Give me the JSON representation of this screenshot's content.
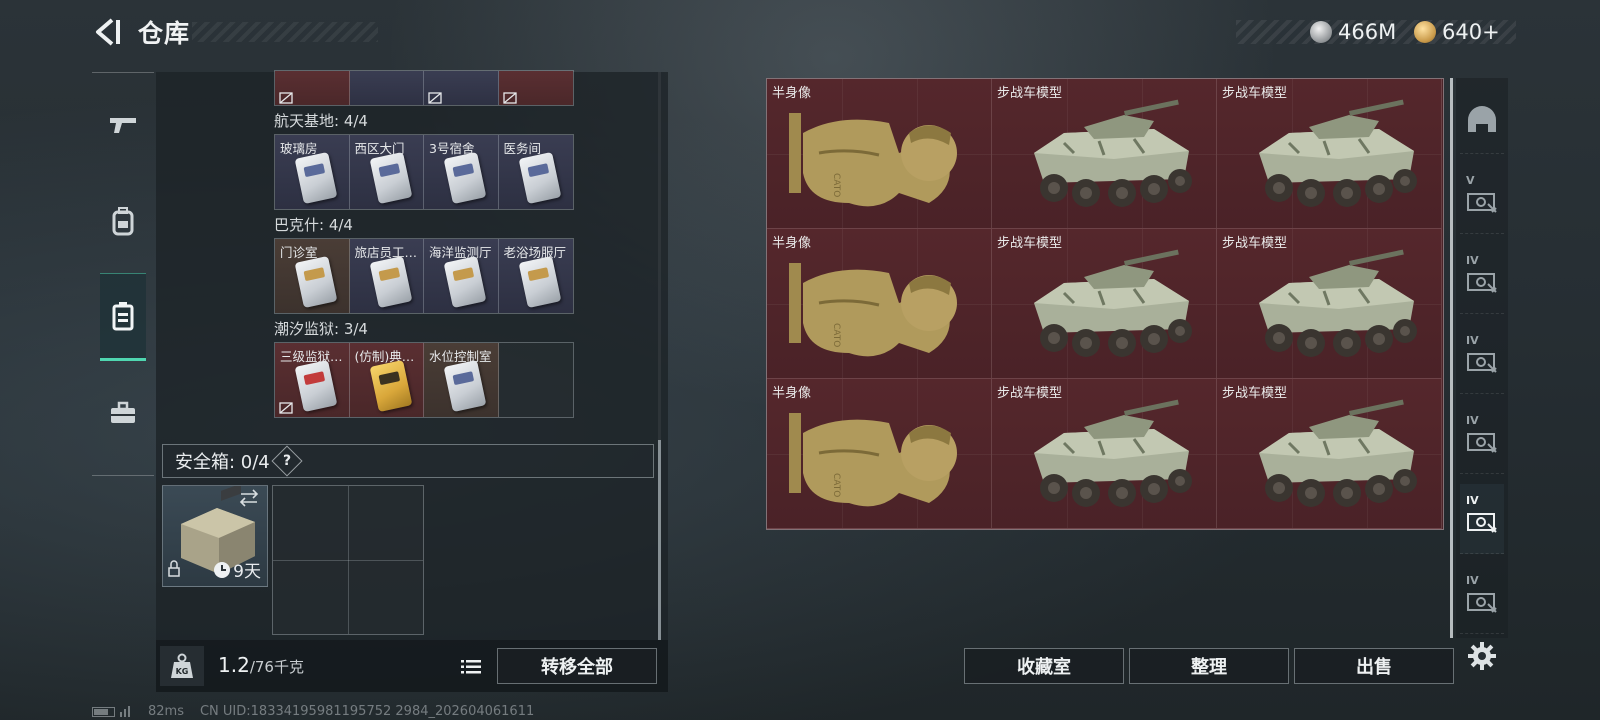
{
  "header": {
    "title": "仓库"
  },
  "currency": [
    {
      "name": "silver-coin",
      "value": "466M"
    },
    {
      "name": "gold-coin",
      "value": "640+"
    }
  ],
  "left_nav": [
    {
      "icon": "gun-icon"
    },
    {
      "icon": "backpack-icon"
    },
    {
      "icon": "key-case-icon",
      "active": true
    },
    {
      "icon": "toolbox-icon"
    }
  ],
  "storage": {
    "groups": [
      {
        "label": "航天基地: 4/4",
        "items": [
          "玻璃房",
          "西区大门",
          "3号宿舍",
          "医务间"
        ]
      },
      {
        "label": "巴克什: 4/4",
        "items": [
          "门诊室",
          "旅店员工…",
          "海洋监测厅",
          "老浴场服厅"
        ]
      },
      {
        "label": "潮汐监狱: 3/4",
        "items": [
          "三级监狱…",
          "(仿制)典…",
          "水位控制室"
        ]
      }
    ]
  },
  "safebox": {
    "label": "安全箱: 0/4",
    "help": "?",
    "days": "9天"
  },
  "weight": {
    "current": "1.2",
    "max": "/76千克"
  },
  "buttons": {
    "transfer_all": "转移全部",
    "collection": "收藏室",
    "organize": "整理",
    "sell": "出售"
  },
  "grid_items": [
    {
      "label": "半身像",
      "type": "bust"
    },
    {
      "label": "步战车模型",
      "type": "ifv"
    },
    {
      "label": "步战车模型",
      "type": "ifv"
    },
    {
      "label": "半身像",
      "type": "bust"
    },
    {
      "label": "步战车模型",
      "type": "ifv"
    },
    {
      "label": "步战车模型",
      "type": "ifv"
    },
    {
      "label": "半身像",
      "type": "bust"
    },
    {
      "label": "步战车模型",
      "type": "ifv"
    },
    {
      "label": "步战车模型",
      "type": "ifv"
    }
  ],
  "filter_column": [
    {
      "icon": "helmet-icon"
    },
    {
      "icon": "tier-v-item-icon",
      "text": "V"
    },
    {
      "icon": "tier-iv-item-icon",
      "text": "IV"
    },
    {
      "icon": "tier-iv-item-icon",
      "text": "IV"
    },
    {
      "icon": "tier-iv-item-icon",
      "text": "IV"
    },
    {
      "icon": "tier-iv-item-icon",
      "text": "IV",
      "active": true
    },
    {
      "icon": "tier-iv-item-icon",
      "text": "IV"
    }
  ],
  "status": {
    "ping": "82ms",
    "uid": "CN UID:18334195981195752 2984_202604061611"
  },
  "colors": {
    "accent": "#4fd6b0",
    "collectible_bg": "#4a2328"
  }
}
